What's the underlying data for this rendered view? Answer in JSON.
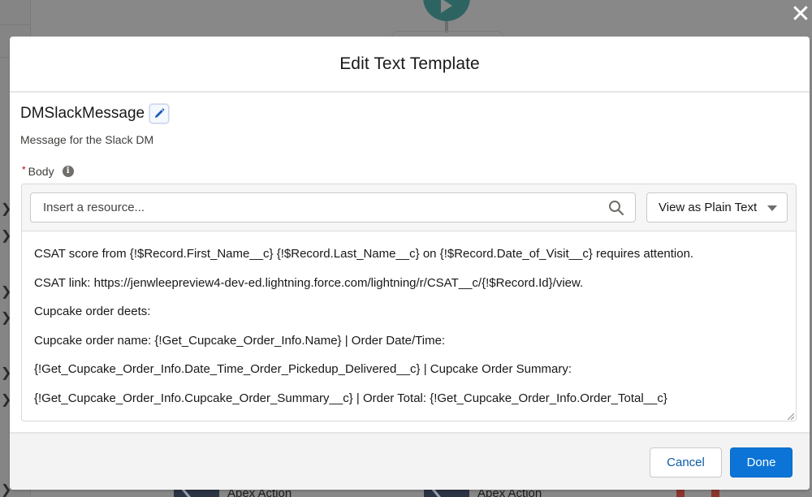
{
  "background": {
    "sidebar_chevrons": [
      "chevron-right",
      "chevron-right",
      "chevron-right",
      "chevron-right",
      "chevron-right",
      "chevron-right",
      "chevron-right"
    ],
    "canvas_nodes": [
      {
        "label": "Apex Action"
      },
      {
        "label": "Apex Action"
      }
    ]
  },
  "overlay": {
    "close_icon": "close-icon"
  },
  "modal": {
    "title": "Edit Text Template",
    "template_name": "DMSlackMessage",
    "edit_icon": "pencil-icon",
    "description": "Message for the Slack DM",
    "body_field": {
      "label": "Body",
      "required_marker": "*",
      "info_icon": "info-icon",
      "resource_search": {
        "value": "",
        "placeholder": "Insert a resource...",
        "icon": "search-icon"
      },
      "view_mode": {
        "selected": "View as Plain Text",
        "icon": "caret-down-icon"
      },
      "lines": [
        "CSAT score from {!$Record.First_Name__c}  {!$Record.Last_Name__c} on {!$Record.Date_of_Visit__c} requires attention.",
        "CSAT link: https://jenwleepreview4-dev-ed.lightning.force.com/lightning/r/CSAT__c/{!$Record.Id}/view.",
        "Cupcake order deets:",
        "Cupcake order name: {!Get_Cupcake_Order_Info.Name} | Order Date/Time:",
        "{!Get_Cupcake_Order_Info.Date_Time_Order_Pickedup_Delivered__c} | Cupcake Order Summary:",
        "{!Get_Cupcake_Order_Info.Cupcake_Order_Summary__c} | Order Total:  {!Get_Cupcake_Order_Info.Order_Total__c}"
      ]
    },
    "footer": {
      "cancel_label": "Cancel",
      "done_label": "Done"
    },
    "colors": {
      "brand_blue": "#0b74d6",
      "link_blue": "#0b5cab",
      "required_red": "#ba0517"
    }
  }
}
